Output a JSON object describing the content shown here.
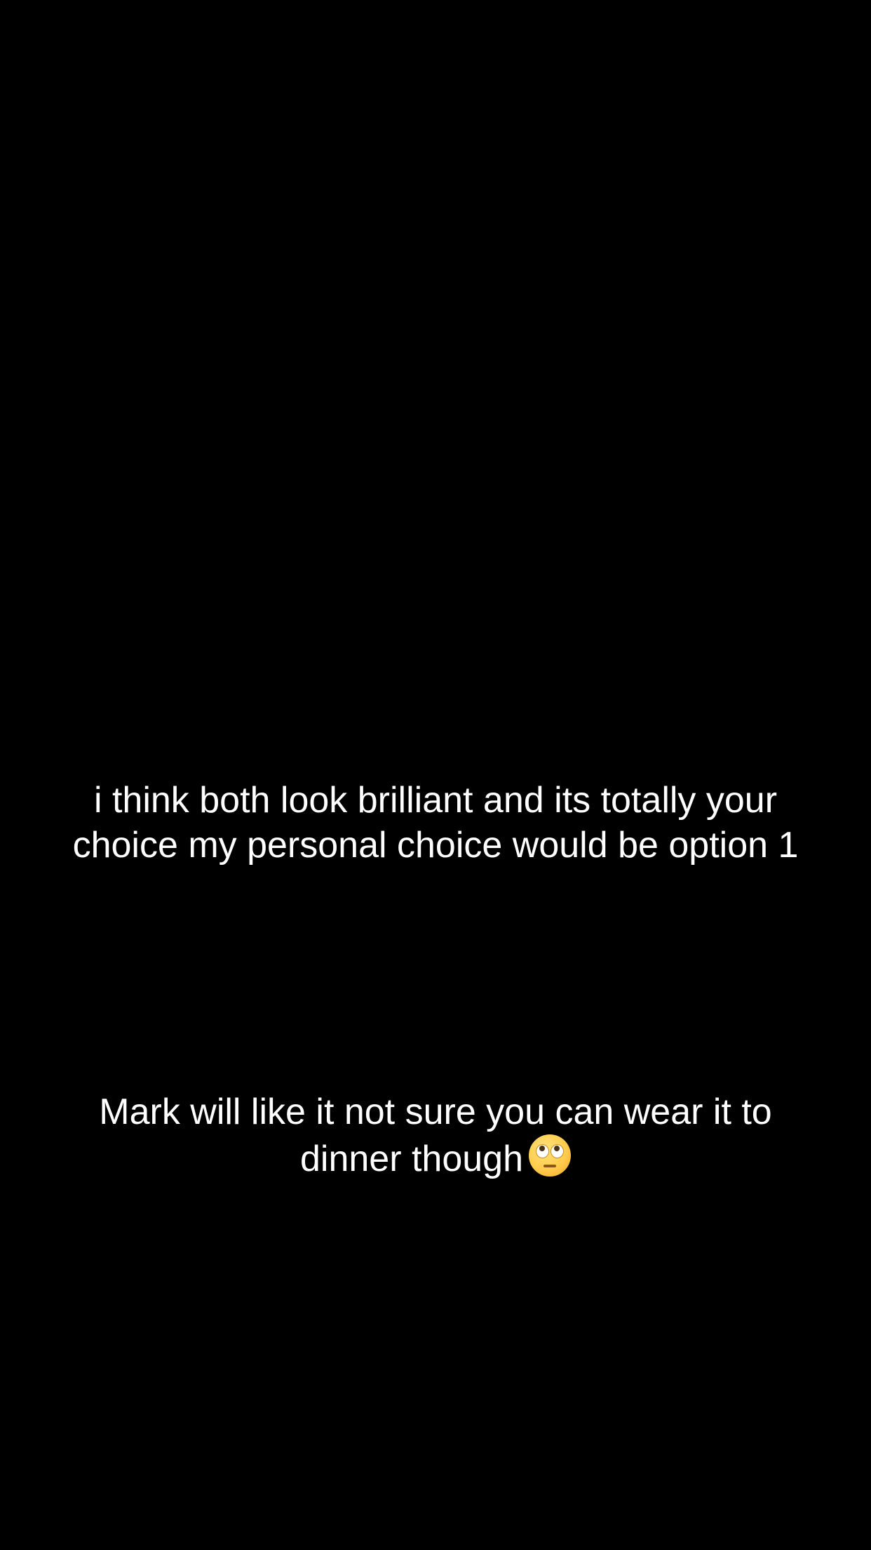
{
  "background_color": "#000000",
  "text_color": "#ffffff",
  "captions": [
    {
      "text": "i think both look brilliant and its totally your\nchoice my personal choice would be option 1"
    },
    {
      "text": "Mark will like it not sure you can wear it to\ndinner though",
      "emoji": "face-with-rolling-eyes-icon"
    }
  ]
}
